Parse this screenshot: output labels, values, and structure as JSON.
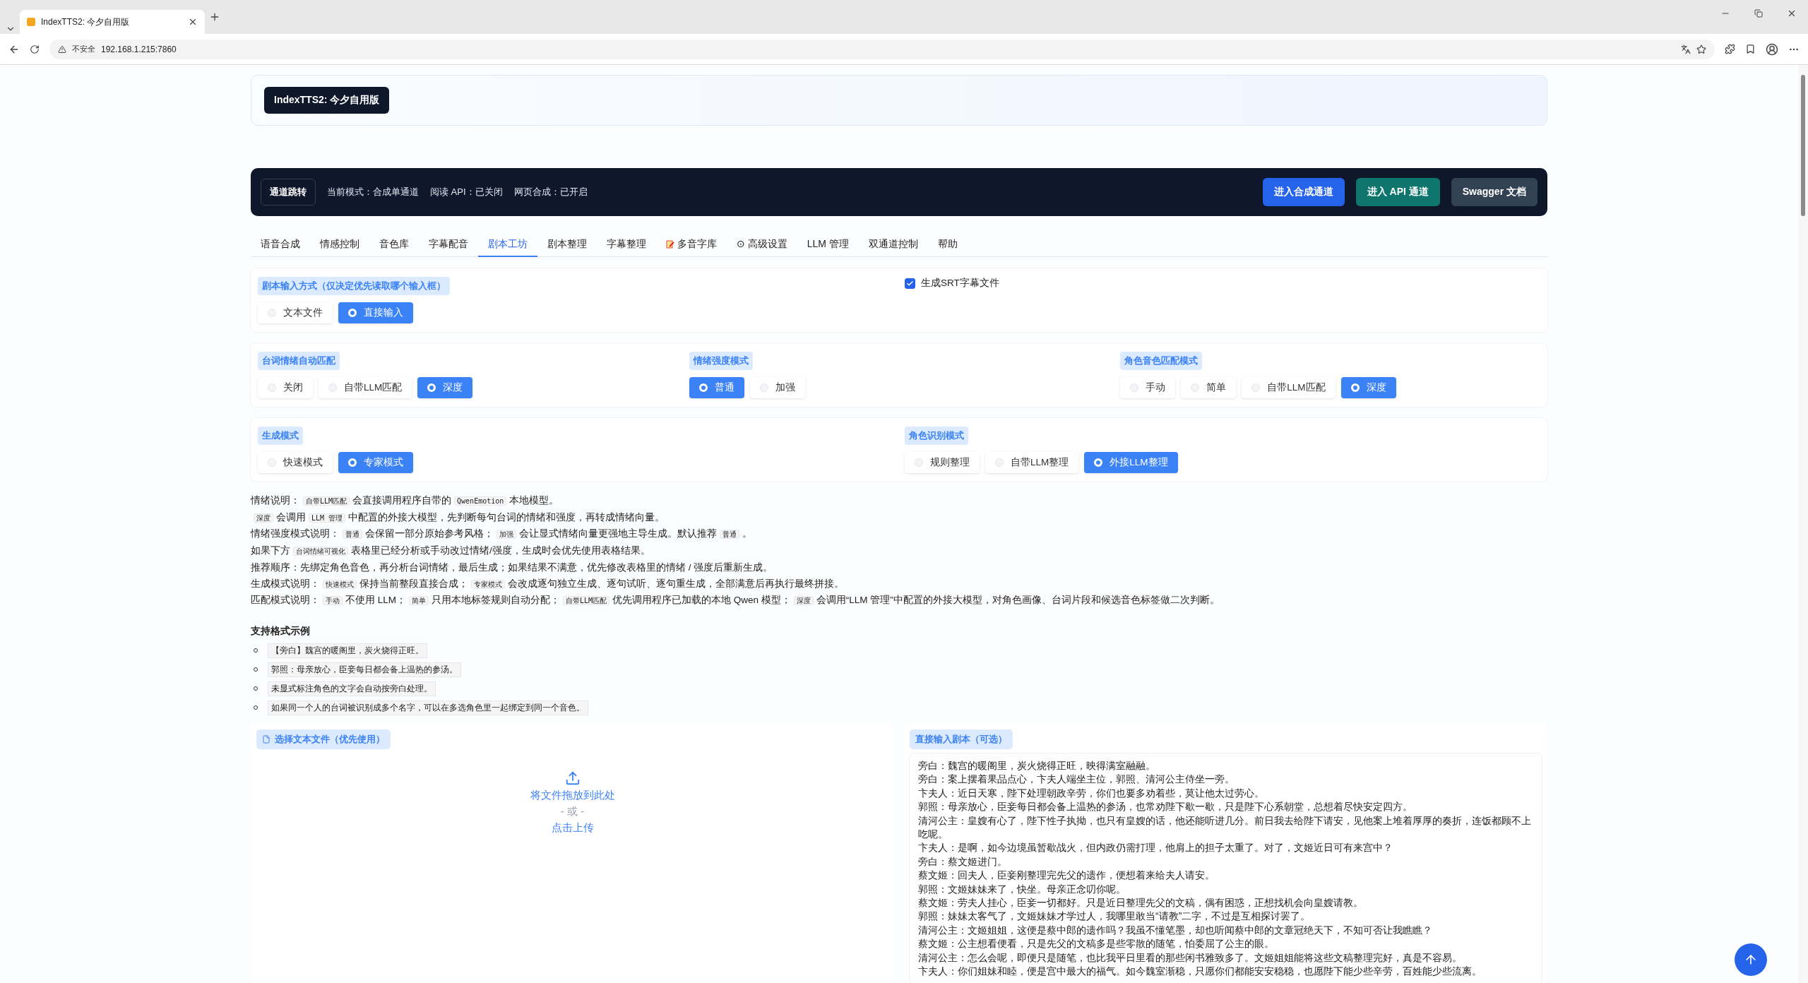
{
  "browser": {
    "tab_title": "IndexTTS2: 今夕自用版",
    "security_label": "不安全",
    "url": "192.168.1.215:7860"
  },
  "header": {
    "title": "IndexTTS2: 今夕自用版"
  },
  "nav": {
    "jump_label": "通道跳转",
    "status": [
      "当前模式：合成单通道",
      "阅读 API：已关闭",
      "网页合成：已开启"
    ],
    "actions": [
      {
        "label": "进入合成通道",
        "kind": "primary"
      },
      {
        "label": "进入 API 通道",
        "kind": "teal"
      },
      {
        "label": "Swagger 文档",
        "kind": "dark"
      }
    ]
  },
  "tabs": [
    {
      "label": "语音合成",
      "selected": false
    },
    {
      "label": "情感控制",
      "selected": false
    },
    {
      "label": "音色库",
      "selected": false
    },
    {
      "label": "字幕配音",
      "selected": false
    },
    {
      "label": "剧本工坊",
      "selected": true
    },
    {
      "label": "剧本整理",
      "selected": false
    },
    {
      "label": "字幕整理",
      "selected": false
    },
    {
      "label": "多音字库",
      "selected": false,
      "kind": "icon"
    },
    {
      "label": "⊙ 高级设置",
      "selected": false
    },
    {
      "label": "LLM 管理",
      "selected": false
    },
    {
      "label": "双通道控制",
      "selected": false
    },
    {
      "label": "帮助",
      "selected": false
    }
  ],
  "sections": [
    {
      "groups": [
        {
          "kind": "radio",
          "label": "剧本输入方式（仅决定优先读取哪个输入框）",
          "options": [
            {
              "label": "文本文件",
              "selected": false
            },
            {
              "label": "直接输入",
              "selected": true
            }
          ]
        },
        {
          "kind": "checkbox",
          "label": "生成SRT字幕文件",
          "checked": true
        }
      ]
    },
    {
      "groups": [
        {
          "kind": "radio",
          "label": "台词情绪自动匹配",
          "options": [
            {
              "label": "关闭",
              "selected": false
            },
            {
              "label": "自带LLM匹配",
              "selected": false
            },
            {
              "label": "深度",
              "selected": true
            }
          ]
        },
        {
          "kind": "radio",
          "label": "情绪强度模式",
          "options": [
            {
              "label": "普通",
              "selected": true
            },
            {
              "label": "加强",
              "selected": false
            }
          ]
        },
        {
          "kind": "radio",
          "label": "角色音色匹配模式",
          "options": [
            {
              "label": "手动",
              "selected": false
            },
            {
              "label": "简单",
              "selected": false
            },
            {
              "label": "自带LLM匹配",
              "selected": false
            },
            {
              "label": "深度",
              "selected": true
            }
          ]
        }
      ]
    },
    {
      "groups": [
        {
          "kind": "radio",
          "label": "生成模式",
          "options": [
            {
              "label": "快速模式",
              "selected": false
            },
            {
              "label": "专家模式",
              "selected": true
            }
          ]
        },
        {
          "kind": "radio",
          "label": "角色识别模式",
          "options": [
            {
              "label": "规则整理",
              "selected": false
            },
            {
              "label": "自带LLM整理",
              "selected": false
            },
            {
              "label": "外接LLM整理",
              "selected": true
            }
          ]
        }
      ]
    }
  ],
  "notes": [
    [
      {
        "kind": "text",
        "text": "情绪说明："
      },
      {
        "kind": "code",
        "text": "自带LLM匹配"
      },
      {
        "kind": "text",
        "text": "会直接调用程序自带的"
      },
      {
        "kind": "code",
        "text": "QwenEmotion"
      },
      {
        "kind": "text",
        "text": "本地模型。"
      }
    ],
    [
      {
        "kind": "code",
        "text": "深度"
      },
      {
        "kind": "text",
        "text": "会调用"
      },
      {
        "kind": "code",
        "text": "LLM 管理"
      },
      {
        "kind": "text",
        "text": "中配置的外接大模型，先判断每句台词的情绪和强度，再转成情绪向量。"
      }
    ],
    [
      {
        "kind": "text",
        "text": "情绪强度模式说明："
      },
      {
        "kind": "code",
        "text": "普通"
      },
      {
        "kind": "text",
        "text": "会保留一部分原始参考风格；"
      },
      {
        "kind": "code",
        "text": "加强"
      },
      {
        "kind": "text",
        "text": "会让显式情绪向量更强地主导生成。默认推荐"
      },
      {
        "kind": "code",
        "text": "普通"
      },
      {
        "kind": "text",
        "text": "。"
      }
    ],
    [
      {
        "kind": "text",
        "text": "如果下方"
      },
      {
        "kind": "code",
        "text": "台词情绪可视化"
      },
      {
        "kind": "text",
        "text": "表格里已经分析或手动改过情绪/强度，生成时会优先使用表格结果。"
      }
    ],
    [
      {
        "kind": "text",
        "text": "推荐顺序：先绑定角色音色，再分析台词情绪，最后生成；如果结果不满意，优先修改表格里的情绪 / 强度后重新生成。"
      }
    ],
    [
      {
        "kind": "text",
        "text": "生成模式说明："
      },
      {
        "kind": "code",
        "text": "快速模式"
      },
      {
        "kind": "text",
        "text": "保持当前整段直接合成；"
      },
      {
        "kind": "code",
        "text": "专家模式"
      },
      {
        "kind": "text",
        "text": "会改成逐句独立生成、逐句试听、逐句重生成，全部满意后再执行最终拼接。"
      }
    ],
    [
      {
        "kind": "text",
        "text": "匹配模式说明："
      },
      {
        "kind": "code",
        "text": "手动"
      },
      {
        "kind": "text",
        "text": "不使用 LLM；"
      },
      {
        "kind": "code",
        "text": "简单"
      },
      {
        "kind": "text",
        "text": "只用本地标签规则自动分配；"
      },
      {
        "kind": "code",
        "text": "自带LLM匹配"
      },
      {
        "kind": "text",
        "text": "优先调用程序已加载的本地 Qwen 模型；"
      },
      {
        "kind": "code",
        "text": "深度"
      },
      {
        "kind": "text",
        "text": "会调用“LLM 管理”中配置的外接大模型，对角色画像、台词片段和候选音色标签做二次判断。"
      }
    ]
  ],
  "formats": {
    "title": "支持格式示例",
    "items": [
      "【旁白】魏宫的暖阁里，炭火烧得正旺。",
      "郭照：母亲放心，臣妾每日都会备上温热的参汤。",
      "未显式标注角色的文字会自动按旁白处理。",
      "如果同一个人的台词被识别成多个名字，可以在多选角色里一起绑定到同一个音色。"
    ]
  },
  "upload": {
    "label": "选择文本文件（优先使用）",
    "drop_text": "将文件拖放到此处",
    "or_text": "- 或 -",
    "click_text": "点击上传"
  },
  "script": {
    "label": "直接输入剧本（可选）",
    "lines": [
      "旁白：魏宫的暖阁里，炭火烧得正旺，映得满室融融。",
      "旁白：案上摆着果品点心，卞夫人端坐主位，郭照、清河公主侍坐一旁。",
      "卞夫人：近日天寒，陛下处理朝政辛劳，你们也要多劝着些，莫让他太过劳心。",
      "郭照：母亲放心，臣妾每日都会备上温热的参汤，也常劝陛下歇一歇，只是陛下心系朝堂，总想着尽快安定四方。",
      "清河公主：皇嫂有心了，陛下性子执拗，也只有皇嫂的话，他还能听进几分。前日我去给陛下请安，见他案上堆着厚厚的奏折，连饭都顾不上吃呢。",
      "卞夫人：是啊，如今边境虽暂歇战火，但内政仍需打理，他肩上的担子太重了。对了，文姬近日可有来宫中？",
      "旁白：蔡文姬进门。",
      "蔡文姬：回夫人，臣妾刚整理完先父的遗作，便想着来给夫人请安。",
      "郭照：文姬妹妹来了，快坐。母亲正念叨你呢。",
      "蔡文姬：劳夫人挂心，臣妾一切都好。只是近日整理先父的文稿，偶有困惑，正想找机会向皇嫂请教。",
      "郭照：妹妹太客气了，文姬妹妹才学过人，我哪里敢当“请教”二字，不过是互相探讨罢了。",
      "清河公主：文姬姐姐，这便是蔡中郎的遗作吗？我虽不懂笔墨，却也听闻蔡中郎的文章冠绝天下，不知可否让我瞧瞧？",
      "蔡文姬：公主想看便看，只是先父的文稿多是些零散的随笔，怕委屈了公主的眼。",
      "清河公主：怎么会呢，即便只是随笔，也比我平日里看的那些闲书雅致多了。文姬姐姐能将这些文稿整理完好，真是不容易。",
      "卞夫人：你们姐妹和睦，便是宫中最大的福气。如今魏室渐稳，只愿你们都能安安稳稳，也愿陛下能少些辛劳，百姓能少些流离。"
    ]
  }
}
